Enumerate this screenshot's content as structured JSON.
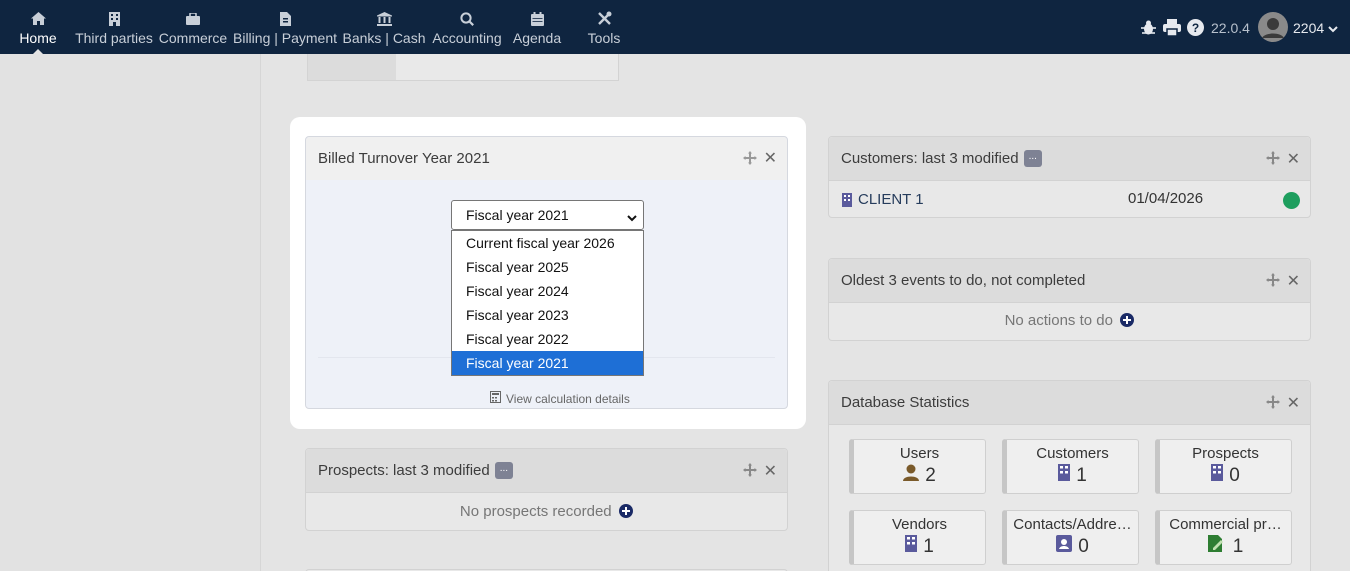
{
  "nav": {
    "items": [
      {
        "label": "Home",
        "icon": "home-icon"
      },
      {
        "label": "Third parties",
        "icon": "building-icon"
      },
      {
        "label": "Commerce",
        "icon": "briefcase-icon"
      },
      {
        "label": "Billing | Payment",
        "icon": "invoice-icon"
      },
      {
        "label": "Banks | Cash",
        "icon": "bank-icon"
      },
      {
        "label": "Accounting",
        "icon": "search-dollar-icon"
      },
      {
        "label": "Agenda",
        "icon": "calendar-icon"
      },
      {
        "label": "Tools",
        "icon": "tools-icon"
      }
    ],
    "version": "22.0.4",
    "user": "2204"
  },
  "modal": {
    "title": "Billed Turnover Year 2021",
    "select_value": "Fiscal year 2021",
    "options": [
      "Current fiscal year 2026",
      "Fiscal year 2025",
      "Fiscal year 2024",
      "Fiscal year 2023",
      "Fiscal year 2022",
      "Fiscal year 2021"
    ],
    "calc_link": "View calculation details"
  },
  "prospects": {
    "title": "Prospects: last 3 modified",
    "badge": "...",
    "empty": "No prospects recorded"
  },
  "customers": {
    "title": "Customers: last 3 modified",
    "badge": "...",
    "row": {
      "name": "CLIENT 1",
      "date": "01/04/2026",
      "status_color": "#1e9e5e"
    }
  },
  "events": {
    "title": "Oldest 3 events to do, not completed",
    "empty": "No actions to do"
  },
  "stats": {
    "title": "Database Statistics",
    "cards": [
      {
        "title": "Users",
        "value": "2",
        "icon": "user-icon"
      },
      {
        "title": "Customers",
        "value": "1",
        "icon": "building-icon"
      },
      {
        "title": "Prospects",
        "value": "0",
        "icon": "building-icon"
      },
      {
        "title": "Vendors",
        "value": "1",
        "icon": "building-icon"
      },
      {
        "title": "Contacts/Addre…",
        "value": "0",
        "icon": "contact-card-icon"
      },
      {
        "title": "Commercial pr…",
        "value": "1",
        "icon": "proposal-icon"
      }
    ]
  },
  "colors": {
    "topbar": "#0f2540",
    "accent": "#1e6fd6",
    "icon_purple": "#5a5a9c"
  }
}
